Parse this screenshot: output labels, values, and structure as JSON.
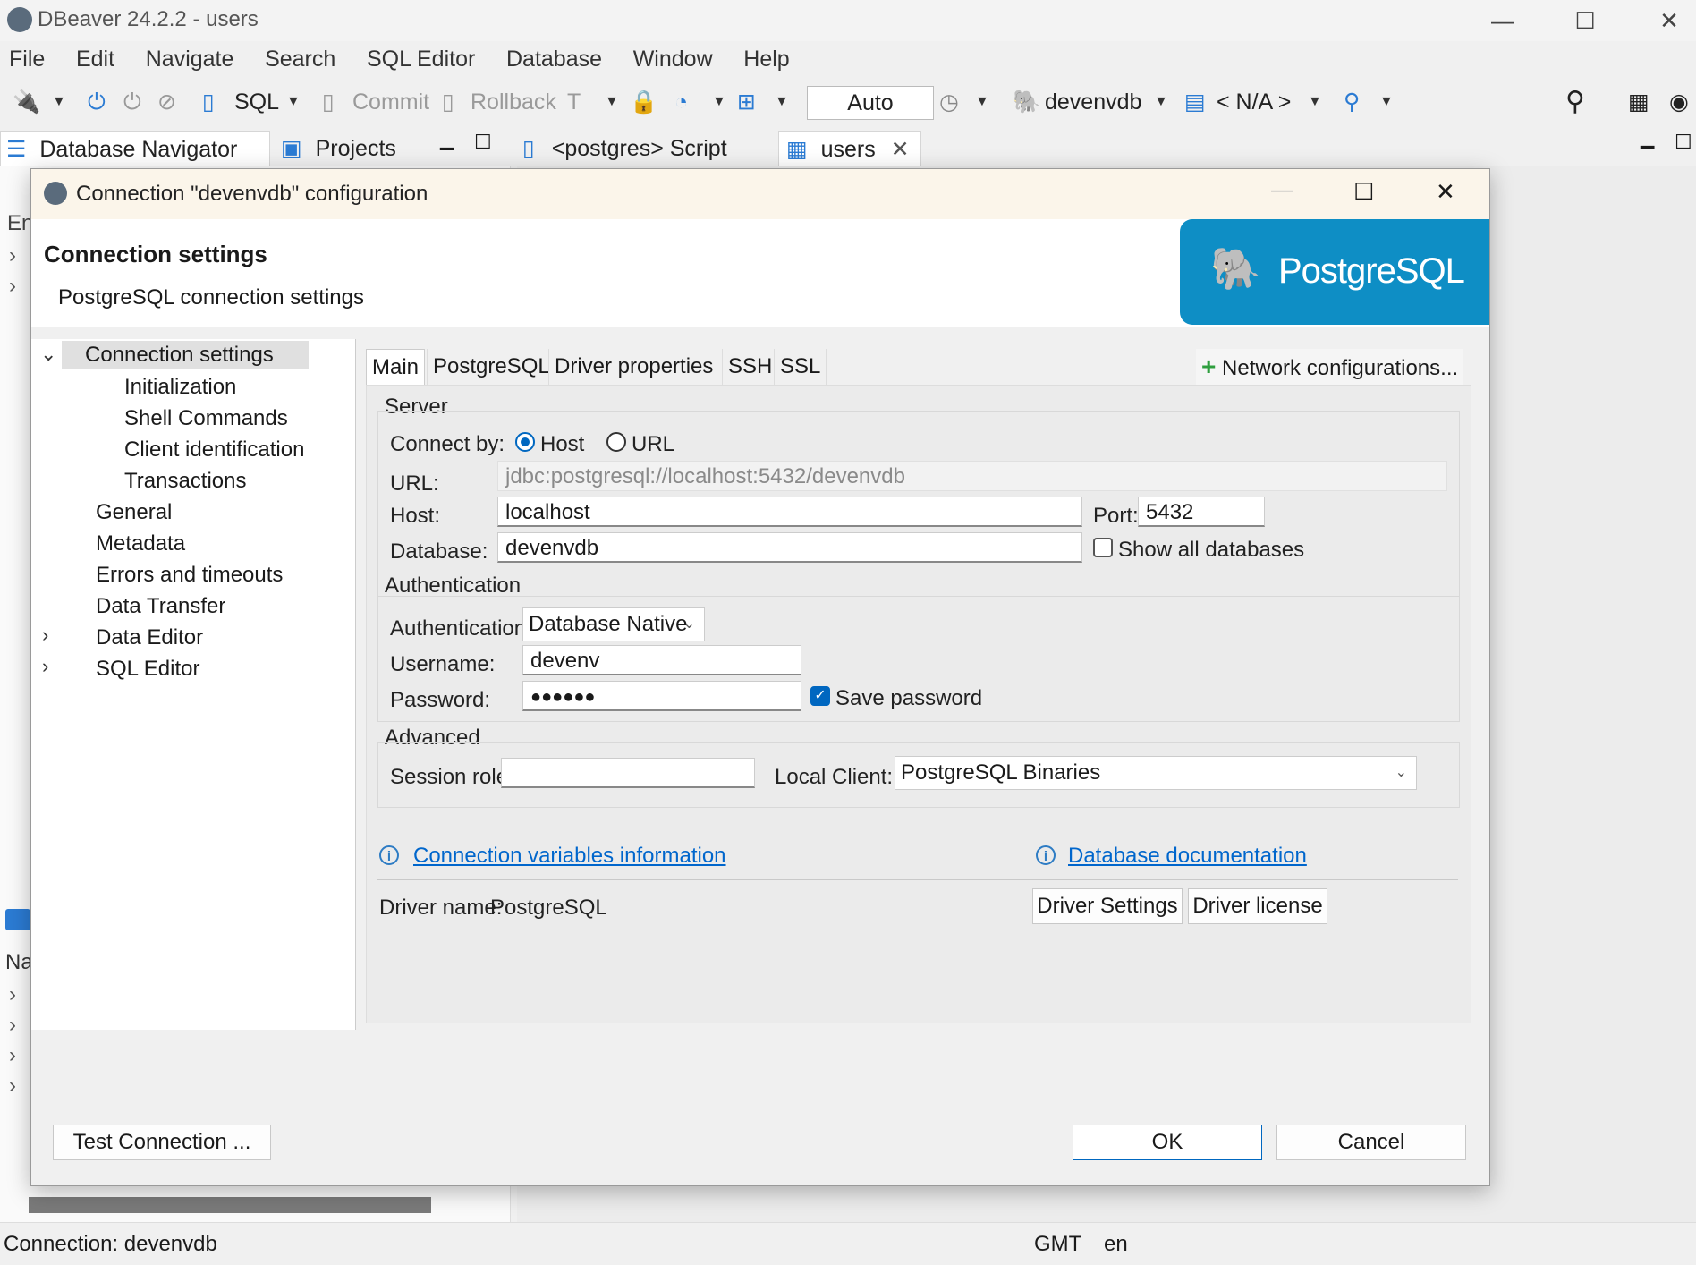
{
  "window": {
    "title": "DBeaver 24.2.2 - users"
  },
  "menu": [
    "File",
    "Edit",
    "Navigate",
    "Search",
    "SQL Editor",
    "Database",
    "Window",
    "Help"
  ],
  "toolbar": {
    "sql": "SQL",
    "commit": "Commit",
    "rollback": "Rollback",
    "auto": "Auto",
    "datasource": "devenvdb",
    "schema": "< N/A >"
  },
  "view_tabs": {
    "navigator": "Database Navigator",
    "projects": "Projects",
    "script": "<postgres> Script",
    "users": "users"
  },
  "left_fragments": {
    "en": "En",
    "na": "Na"
  },
  "dialog": {
    "title": "Connection \"devenvdb\" configuration",
    "header_title": "Connection settings",
    "header_subtitle": "PostgreSQL connection settings",
    "logo_text": "PostgreSQL",
    "tree": {
      "root": "Connection settings",
      "children": [
        "Initialization",
        "Shell Commands",
        "Client identification",
        "Transactions"
      ],
      "items": [
        "General",
        "Metadata",
        "Errors and timeouts",
        "Data Transfer",
        "Data Editor",
        "SQL Editor"
      ]
    },
    "tabs": [
      "Main",
      "PostgreSQL",
      "Driver properties",
      "SSH",
      "SSL"
    ],
    "network_config": "Network configurations...",
    "server": {
      "title": "Server",
      "connect_by_label": "Connect by:",
      "host_option": "Host",
      "url_option": "URL",
      "url_label": "URL:",
      "url_value": "jdbc:postgresql://localhost:5432/devenvdb",
      "host_label": "Host:",
      "host_value": "localhost",
      "port_label": "Port:",
      "port_value": "5432",
      "database_label": "Database:",
      "database_value": "devenvdb",
      "show_all_label": "Show all databases"
    },
    "auth": {
      "title": "Authentication",
      "auth_label": "Authentication:",
      "auth_value": "Database Native",
      "username_label": "Username:",
      "username_value": "devenv",
      "password_label": "Password:",
      "password_value": "●●●●●●",
      "save_password_label": "Save password"
    },
    "advanced": {
      "title": "Advanced",
      "session_role_label": "Session role:",
      "session_role_value": "",
      "local_client_label": "Local Client:",
      "local_client_value": "PostgreSQL Binaries"
    },
    "links": {
      "conn_vars": "Connection variables information",
      "db_docs": "Database documentation"
    },
    "driver": {
      "name_label": "Driver name:",
      "name_value": "PostgreSQL",
      "settings_button": "Driver Settings",
      "license_button": "Driver license"
    },
    "buttons": {
      "test": "Test Connection ...",
      "ok": "OK",
      "cancel": "Cancel"
    }
  },
  "status": {
    "connection": "Connection: devenvdb",
    "timezone": "GMT",
    "locale": "en"
  },
  "colors": {
    "accent": "#0067c0",
    "postgres_brand": "#0e8ec5"
  }
}
